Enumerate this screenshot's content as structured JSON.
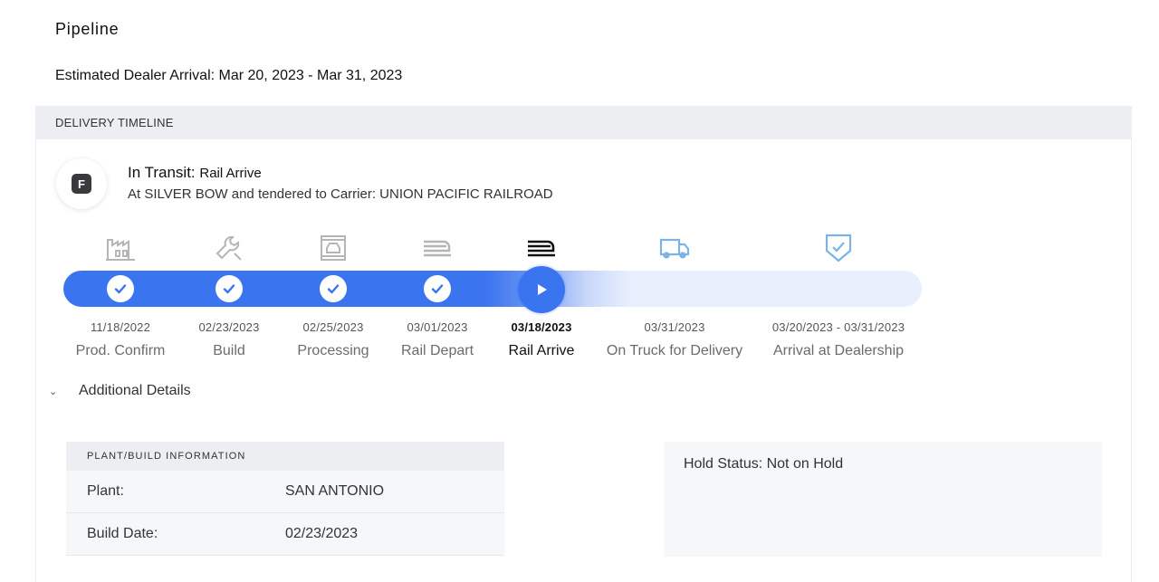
{
  "page": {
    "title": "Pipeline",
    "estimated_arrival": "Estimated Dealer Arrival: Mar 20, 2023 - Mar 31, 2023"
  },
  "timeline": {
    "header": "DELIVERY TIMELINE",
    "badge_letter": "F",
    "status_label": "In Transit:",
    "status_value": "Rail Arrive",
    "carrier_text": "At SILVER BOW and tendered to Carrier: UNION PACIFIC RAILROAD",
    "progress_completed_stages": 4,
    "current_stage_index": 4,
    "stages": [
      {
        "date": "11/18/2022",
        "name": "Prod. Confirm",
        "icon": "factory-icon",
        "state": "complete"
      },
      {
        "date": "02/23/2023",
        "name": "Build",
        "icon": "wrench-icon",
        "state": "complete"
      },
      {
        "date": "02/25/2023",
        "name": "Processing",
        "icon": "vehicle-processing-icon",
        "state": "complete"
      },
      {
        "date": "03/01/2023",
        "name": "Rail Depart",
        "icon": "rail-depart-icon",
        "state": "complete"
      },
      {
        "date": "03/18/2023",
        "name": "Rail Arrive",
        "icon": "rail-arrive-icon",
        "state": "current"
      },
      {
        "date": "03/31/2023",
        "name": "On Truck for Delivery",
        "icon": "truck-icon",
        "state": "upcoming"
      },
      {
        "date": "03/20/2023 - 03/31/2023",
        "name": "Arrival at Dealership",
        "icon": "shield-check-icon",
        "state": "upcoming"
      }
    ],
    "colors": {
      "progress": "#3b74ef",
      "track": "#e8effd",
      "inactive_icon": "#b5b5b5",
      "active_icon": "#111111",
      "upcoming_icon": "#7cb3e6"
    }
  },
  "details": {
    "toggle_label": "Additional Details",
    "plant_table": {
      "header": "PLANT/BUILD INFORMATION",
      "rows": [
        {
          "key": "Plant:",
          "value": "SAN ANTONIO"
        },
        {
          "key": "Build Date:",
          "value": "02/23/2023"
        }
      ]
    },
    "hold_status": "Hold Status: Not on Hold"
  }
}
